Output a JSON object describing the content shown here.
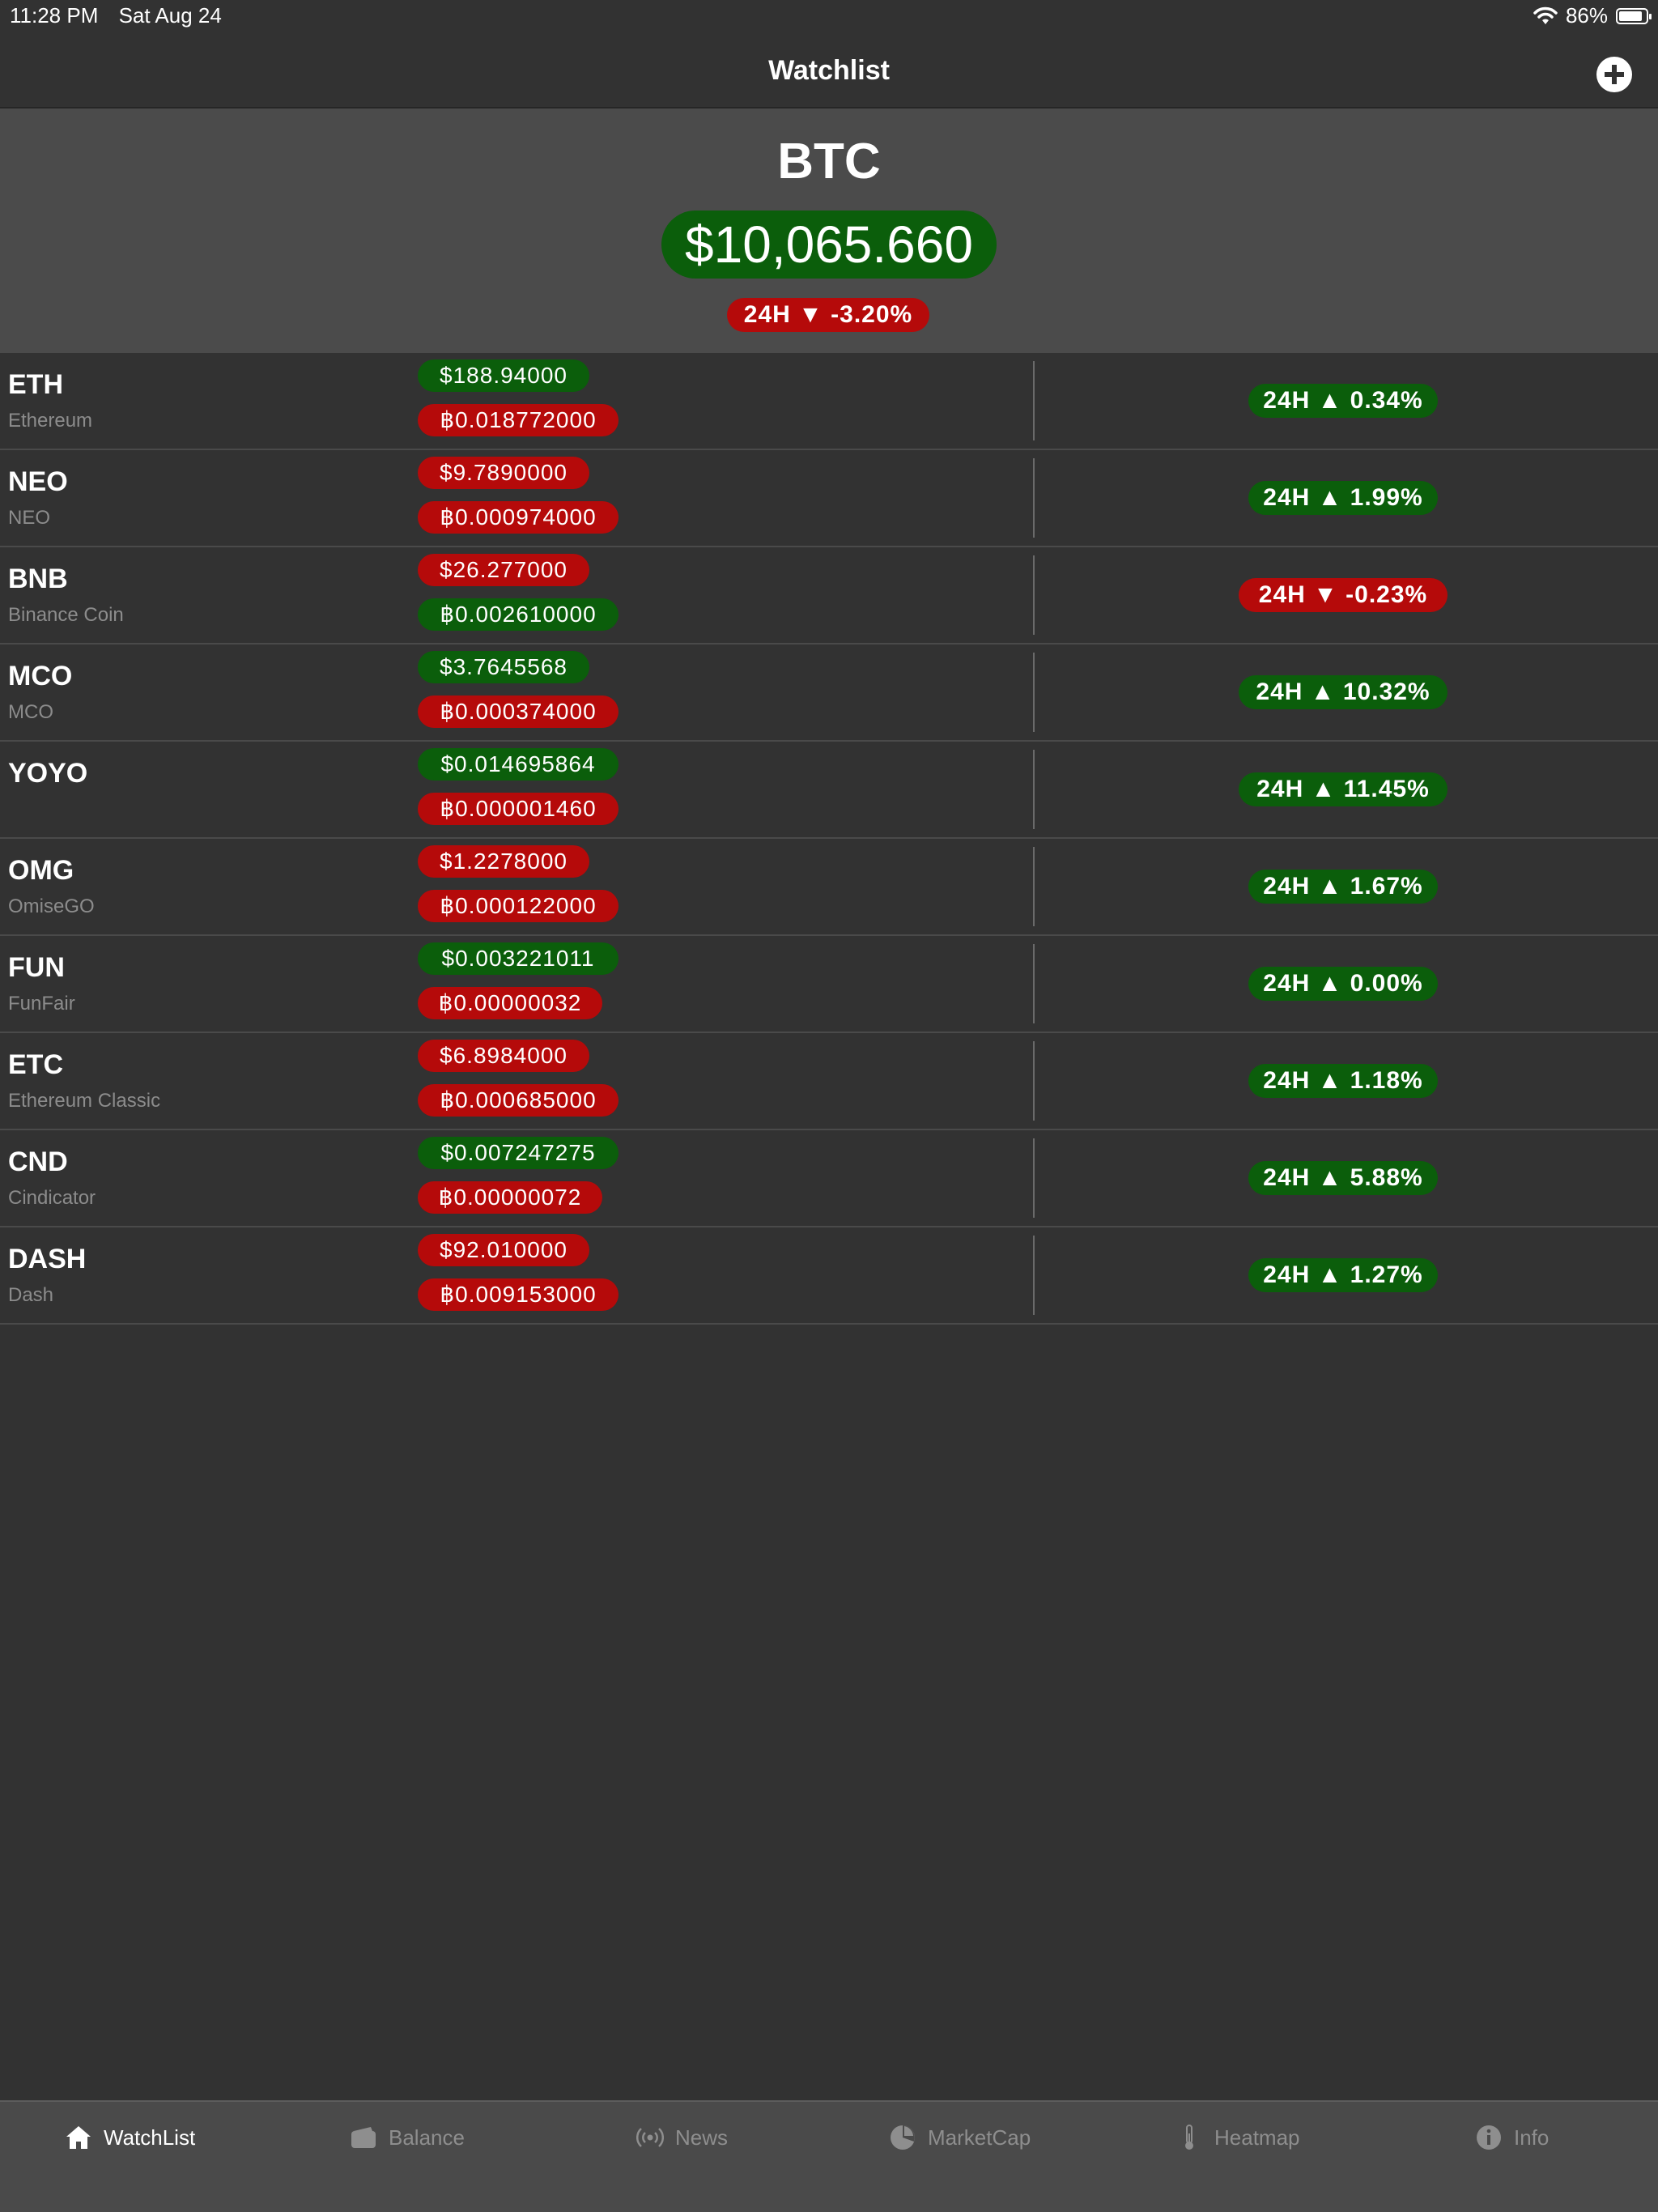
{
  "status_bar": {
    "time": "11:28 PM",
    "date": "Sat Aug 24",
    "battery": "86%",
    "battery_level": 0.86
  },
  "nav": {
    "title": "Watchlist",
    "add_icon": "plus-circle-icon"
  },
  "hero": {
    "symbol": "BTC",
    "price": "$10,065.660",
    "change": "24H ▼ -3.20%",
    "price_color": "#0b5e0b",
    "change_color": "#b50a0a"
  },
  "coins": [
    {
      "symbol": "ETH",
      "name": "Ethereum",
      "usd": "$188.94000",
      "btc": "฿0.018772000",
      "change": "24H ▲ 0.34%"
    },
    {
      "symbol": "NEO",
      "name": "NEO",
      "usd": "$9.7890000",
      "btc": "฿0.000974000",
      "change": "24H ▲ 1.99%"
    },
    {
      "symbol": "BNB",
      "name": "Binance Coin",
      "usd": "$26.277000",
      "btc": "฿0.002610000",
      "change": "24H ▼ -0.23%"
    },
    {
      "symbol": "MCO",
      "name": "MCO",
      "usd": "$3.7645568",
      "btc": "฿0.000374000",
      "change": "24H ▲ 10.32%"
    },
    {
      "symbol": "YOYO",
      "name": "",
      "usd": "$0.014695864",
      "btc": "฿0.000001460",
      "change": "24H ▲ 11.45%"
    },
    {
      "symbol": "OMG",
      "name": "OmiseGO",
      "usd": "$1.2278000",
      "btc": "฿0.000122000",
      "change": "24H ▲ 1.67%"
    },
    {
      "symbol": "FUN",
      "name": "FunFair",
      "usd": "$0.003221011",
      "btc": "฿0.00000032",
      "change": "24H ▲ 0.00%"
    },
    {
      "symbol": "ETC",
      "name": "Ethereum Classic",
      "usd": "$6.8984000",
      "btc": "฿0.000685000",
      "change": "24H ▲ 1.18%"
    },
    {
      "symbol": "CND",
      "name": "Cindicator",
      "usd": "$0.007247275",
      "btc": "฿0.00000072",
      "change": "24H ▲ 5.88%"
    },
    {
      "symbol": "DASH",
      "name": "Dash",
      "usd": "$92.010000",
      "btc": "฿0.009153000",
      "change": "24H ▲ 1.27%"
    }
  ],
  "colors": {
    "green": "#0b5e0b",
    "red": "#b50a0a"
  },
  "tabs": [
    {
      "label": "WatchList",
      "icon": "home-icon",
      "active": true
    },
    {
      "label": "Balance",
      "icon": "wallet-icon",
      "active": false
    },
    {
      "label": "News",
      "icon": "broadcast-icon",
      "active": false
    },
    {
      "label": "MarketCap",
      "icon": "pie-chart-icon",
      "active": false
    },
    {
      "label": "Heatmap",
      "icon": "thermometer-icon",
      "active": false
    },
    {
      "label": "Info",
      "icon": "info-icon",
      "active": false
    }
  ]
}
